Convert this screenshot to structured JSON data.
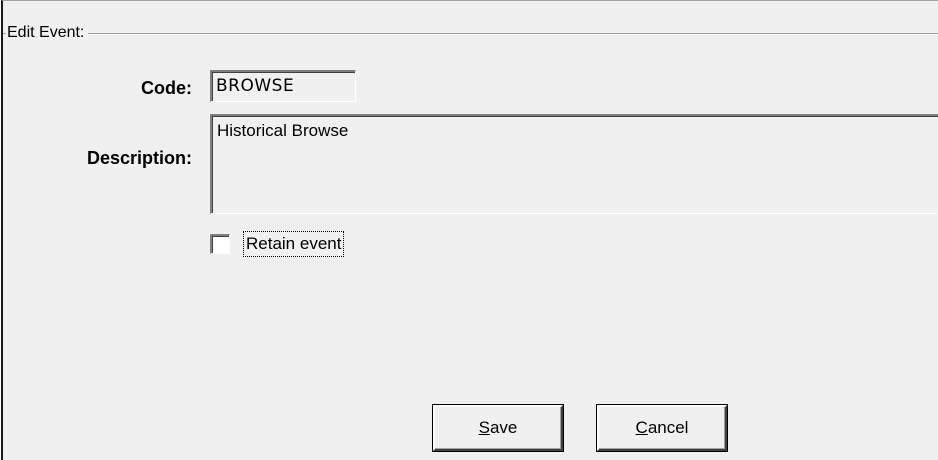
{
  "group": {
    "title": "Edit Event:"
  },
  "fields": {
    "code_label": "Code:",
    "code_value": "BROWSE",
    "description_label": "Description:",
    "description_value": "Historical Browse"
  },
  "checkbox": {
    "label": "Retain event",
    "checked": false
  },
  "buttons": {
    "save": {
      "mnemonic": "S",
      "rest": "ave"
    },
    "cancel": {
      "mnemonic": "C",
      "rest": "ancel"
    }
  }
}
